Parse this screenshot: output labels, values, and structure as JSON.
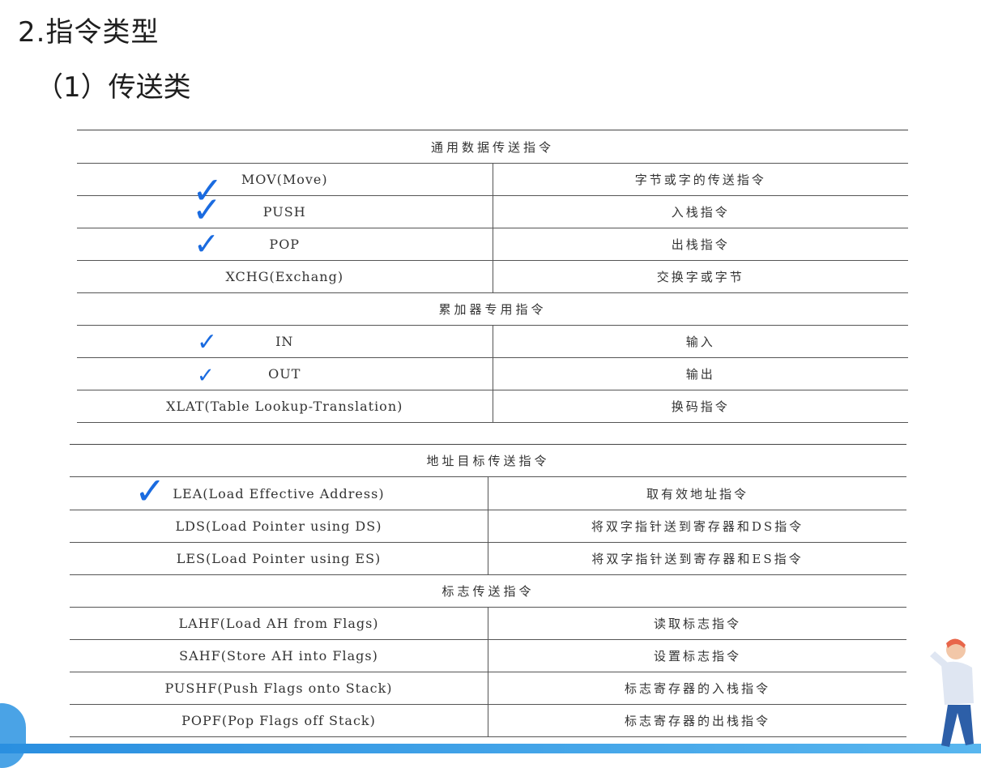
{
  "heading": "2.指令类型",
  "subheading": "（1）传送类",
  "check_glyph": "✓",
  "check_color": "#1a6be0",
  "table1": {
    "sections": [
      {
        "title": "通用数据传送指令",
        "rows": [
          {
            "instr": "MOV(Move)",
            "desc": "字节或字的传送指令",
            "checked": true
          },
          {
            "instr": "PUSH",
            "desc": "入栈指令",
            "checked": true
          },
          {
            "instr": "POP",
            "desc": "出栈指令",
            "checked": true
          },
          {
            "instr": "XCHG(Exchang)",
            "desc": "交换字或字节",
            "checked": false
          }
        ]
      },
      {
        "title": "累加器专用指令",
        "rows": [
          {
            "instr": "IN",
            "desc": "输入",
            "checked": true
          },
          {
            "instr": "OUT",
            "desc": "输出",
            "checked": true
          },
          {
            "instr": "XLAT(Table Lookup-Translation)",
            "desc": "换码指令",
            "checked": false
          }
        ]
      }
    ]
  },
  "table2": {
    "sections": [
      {
        "title": "地址目标传送指令",
        "rows": [
          {
            "instr": "LEA(Load Effective Address)",
            "desc": "取有效地址指令",
            "checked": true
          },
          {
            "instr": "LDS(Load Pointer using DS)",
            "desc": "将双字指针送到寄存器和DS指令",
            "checked": false
          },
          {
            "instr": "LES(Load Pointer using ES)",
            "desc": "将双字指针送到寄存器和ES指令",
            "checked": false
          }
        ]
      },
      {
        "title": "标志传送指令",
        "rows": [
          {
            "instr": "LAHF(Load AH from Flags)",
            "desc": "读取标志指令",
            "checked": false
          },
          {
            "instr": "SAHF(Store AH into Flags)",
            "desc": "设置标志指令",
            "checked": false
          },
          {
            "instr": "PUSHF(Push Flags onto Stack)",
            "desc": "标志寄存器的入栈指令",
            "checked": false
          },
          {
            "instr": "POPF(Pop Flags off Stack)",
            "desc": "标志寄存器的出栈指令",
            "checked": false
          }
        ]
      }
    ]
  }
}
